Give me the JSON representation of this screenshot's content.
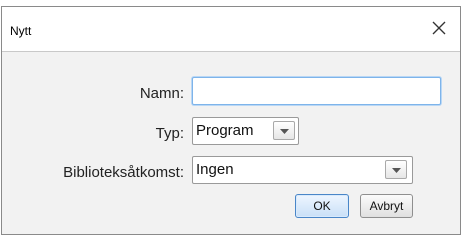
{
  "window": {
    "title": "Nytt",
    "close_icon": "close-icon"
  },
  "form": {
    "name_label": "Namn:",
    "name_value": "",
    "type_label": "Typ:",
    "type_value": "Program",
    "library_label": "Biblioteksåtkomst:",
    "library_value": "Ingen"
  },
  "buttons": {
    "ok": "OK",
    "cancel": "Avbryt"
  },
  "colors": {
    "body_background": "#f2f2f2",
    "focus_border": "#7eb4ea",
    "default_button_border": "#4a86c8"
  }
}
